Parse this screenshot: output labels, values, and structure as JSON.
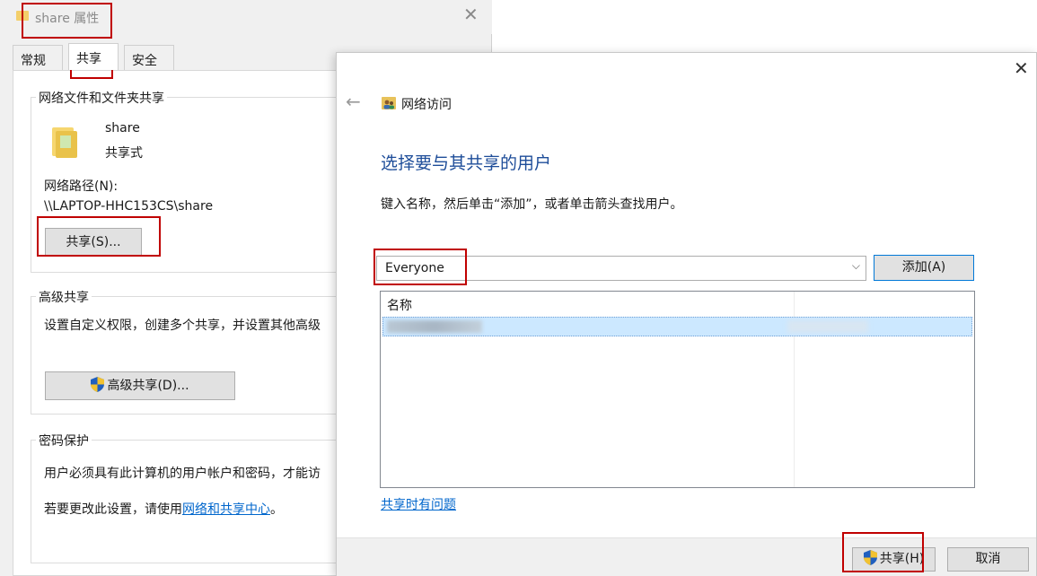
{
  "properties_window": {
    "title": "share 属性",
    "close_glyph": "✕",
    "tabs": [
      "常规",
      "共享",
      "安全"
    ],
    "active_tab": "共享",
    "network_sharing": {
      "group_title": "网络文件和文件夹共享",
      "folder_name": "share",
      "folder_status": "共享式",
      "path_label": "网络路径(N):",
      "path_value": "\\\\LAPTOP-HHC153CS\\share",
      "share_button": "共享(S)..."
    },
    "advanced_sharing": {
      "group_title": "高级共享",
      "description": "设置自定义权限，创建多个共享，并设置其他高级",
      "button": "高级共享(D)..."
    },
    "password_protection": {
      "group_title": "密码保护",
      "description": "用户必须具有此计算机的用户帐户和密码，才能访",
      "change_prefix": "若要更改此设置，请使用",
      "change_link": "网络和共享中心",
      "change_suffix": "。"
    }
  },
  "network_access_dialog": {
    "back_glyph": "←",
    "close_glyph": "✕",
    "header_title": "网络访问",
    "heading": "选择要与其共享的用户",
    "instruction": "键入名称，然后单击“添加”，或者单击箭头查找用户。",
    "user_combo_value": "Everyone",
    "combo_arrow_glyph": "⌵",
    "add_button": "添加(A)",
    "list_header_name": "名称",
    "help_link": "共享时有问题",
    "share_button": "共享(H)",
    "cancel_button": "取消"
  },
  "colors": {
    "highlight_box": "#c00000",
    "heading_blue": "#1e4d99",
    "link_blue": "#0066cc",
    "selection": "#cce8ff"
  }
}
